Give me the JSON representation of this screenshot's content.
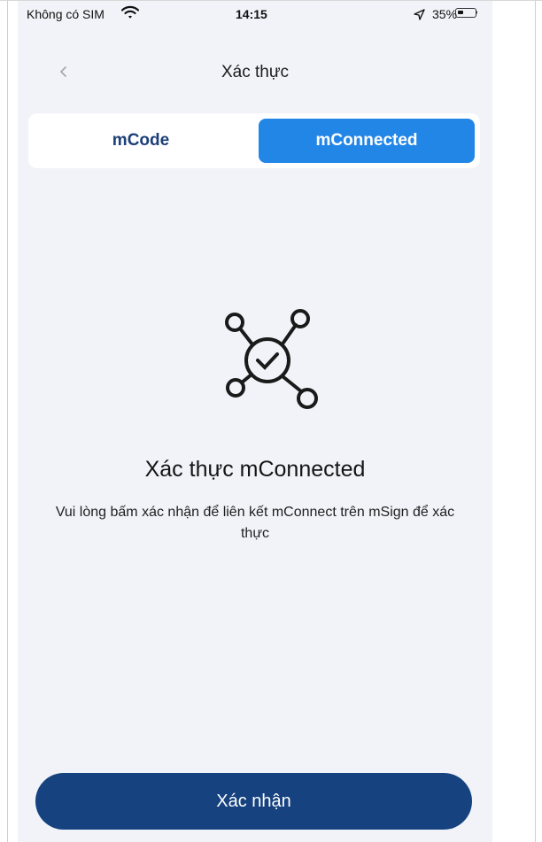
{
  "status_bar": {
    "carrier": "Không có SIM",
    "time": "14:15",
    "battery_percent": "35%",
    "icons": [
      "wifi-icon",
      "location-arrow-icon",
      "battery-icon"
    ],
    "battery_level": 0.35
  },
  "header": {
    "title": "Xác thực",
    "back_icon": "chevron-left-icon"
  },
  "tabs": [
    {
      "label": "mCode",
      "selected": false
    },
    {
      "label": "mConnected",
      "selected": true
    }
  ],
  "content": {
    "illustration_icon": "network-check-icon",
    "heading": "Xác thực mConnected",
    "description": "Vui lòng bấm xác nhận để liên kết mConnect trên mSign để xác thực"
  },
  "confirm_button": {
    "label": "Xác nhận"
  },
  "colors": {
    "accent": "#2286e6",
    "primary_button": "#16427f",
    "background": "#f1f3f9",
    "tab_text": "#1d3f78"
  }
}
